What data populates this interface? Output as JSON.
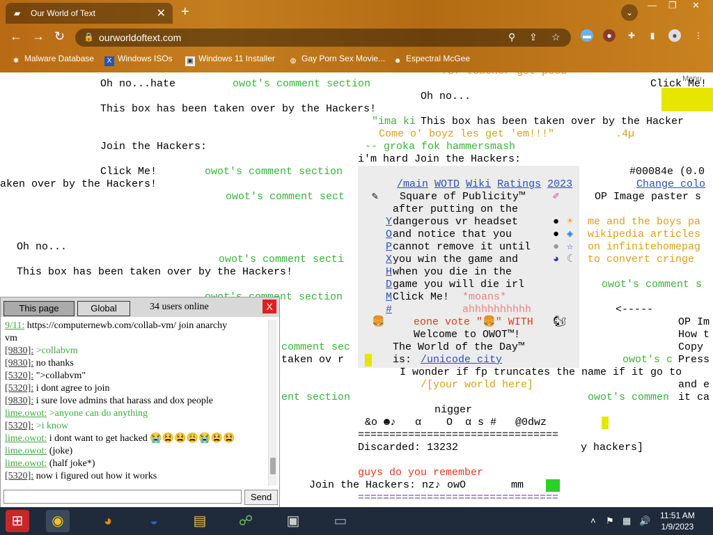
{
  "browser": {
    "tab_title": "Our World of Text",
    "tab_close": "✕",
    "new_tab": "+",
    "url": "ourworldoftext.com",
    "window_controls": {
      "minimize": "—",
      "restore": "❐",
      "close": "✕"
    },
    "bookmarks": [
      {
        "label": "Malware Database",
        "icon": "bug-icon"
      },
      {
        "label": "Windows ISOs",
        "icon": "x-icon"
      },
      {
        "label": "Windows 11 Installer",
        "icon": "image-icon"
      },
      {
        "label": "Gay Porn Sex Movie...",
        "icon": "globe-icon"
      },
      {
        "label": "Espectral McGee",
        "icon": "avatar-icon"
      }
    ]
  },
  "page": {
    "menu_label": "Menu",
    "lines": [
      "Oh no...hate",
      "owot's comment section",
      "Click Me!",
      "Oh no...",
      "This box has been taken over by the Hackers!",
      "\"ima ki",
      "This box has been taken over by the Hacker",
      "Come o' boyz les get 'em!!!\"",
      ".4µ",
      "Join the Hackers:",
      "-- groka fok hammersmash",
      "i'm hard Join the Hackers:",
      "Click Me!",
      "owot's comment section",
      "aken over by the Hackers!",
      "owot's comment sect",
      "Oh no...",
      "owot's comment secti",
      "This box has been taken over by the Hackers!",
      "owot's comment section",
      "comment sec",
      "taken ov r",
      "ent section",
      "fof teacher got peed"
    ],
    "nav_links": [
      "/main",
      "WOTD",
      "Wiki",
      "Ratings",
      "2023"
    ],
    "color_code": "#00084e (0.0",
    "change_color": "Change colo",
    "op_image": "OP Image paster s",
    "publicity": {
      "title": "Square of Publicity™",
      "lines": [
        "after putting on the",
        "dangerous vr headset",
        "and notice that you",
        "cannot remove it until",
        "you win the game and",
        "when you die in the",
        "game you will die irl",
        "Click Me!"
      ],
      "left_letters": [
        "Y",
        "O",
        "P",
        "X",
        "H",
        "D",
        "M",
        "#"
      ],
      "moans": "*moans*",
      "ahh": "ahhhhhhhhhh",
      "vote": "eone vote \"🍔\" WITH"
    },
    "welcome": "Welcome to OWOT™!",
    "wotd_title": "The World of the Day™",
    "wotd_is": "is:",
    "wotd_link": "/unicode_city",
    "wonder": "I wonder if fp truncates the name if it go to",
    "your_world": "/[your world here]",
    "slur": "nigger",
    "symbols": "&o ☻♪   α    O  α s #   @0dwz",
    "rule": "================================",
    "discarded": "Discarded: 13232",
    "hackers_bracket": "y hackers]",
    "remember": "guys do you remember",
    "join_bottom": "Join the Hackers: nz♪ owO",
    "mm": "mm",
    "right_texts": [
      "me and the boys pa",
      "wikipedia articles",
      "on infinitehomepag",
      "to convert cringe",
      "owot's comment s",
      "<-----",
      "OP Im",
      "How t",
      "Copy",
      "Press",
      "and e",
      "it ca",
      "owot's c",
      "owot's commen"
    ]
  },
  "chat": {
    "tab_page": "This page",
    "tab_global": "Global",
    "users_online": "34 users online",
    "close": "X",
    "send": "Send",
    "messages": [
      {
        "user": "9/11:",
        "type": "link-lime",
        "text": "https://computernewb.com/collab-vm/ join anarchy"
      },
      {
        "user": "",
        "type": "cont",
        "text": "vm"
      },
      {
        "user": "[9830]:",
        "type": "link",
        "text": ">collabvm",
        "green": true
      },
      {
        "user": "[9830]:",
        "type": "link",
        "text": "no thanks"
      },
      {
        "user": "[5320]:",
        "type": "link",
        "text": "\">collabvm\""
      },
      {
        "user": "[5320]:",
        "type": "link",
        "text": "i dont agree to join"
      },
      {
        "user": "[9830]:",
        "type": "link",
        "text": "i sure love admins that harass and dox people"
      },
      {
        "user": "lime.owot:",
        "type": "lime",
        "text": ">anyone can do anything",
        "green": true
      },
      {
        "user": "[5320]:",
        "type": "link",
        "text": ">i know",
        "green": true
      },
      {
        "user": "lime.owot:",
        "type": "lime",
        "text": "i dont want to get hacked 😭😫😫😩😭😫😫"
      },
      {
        "user": "lime.owot:",
        "type": "lime",
        "text": "(joke)"
      },
      {
        "user": "lime.owot:",
        "type": "lime",
        "text": "(half joke*)"
      },
      {
        "user": "[5320]:",
        "type": "link",
        "text": "now i figured out how it works"
      }
    ]
  },
  "taskbar": {
    "time": "11:51 AM",
    "date": "1/9/2023",
    "icons": [
      "windows-logo-icon",
      "chrome-icon",
      "firefox-icon",
      "obama-icon",
      "file-explorer-icon",
      "network-icon",
      "printer-icon",
      "computer-icon"
    ]
  },
  "colors": {
    "accent": "#37b437",
    "chrome_frame": "#c47e1e",
    "taskbar": "#1f2b3a",
    "chat_close": "#e02020"
  }
}
